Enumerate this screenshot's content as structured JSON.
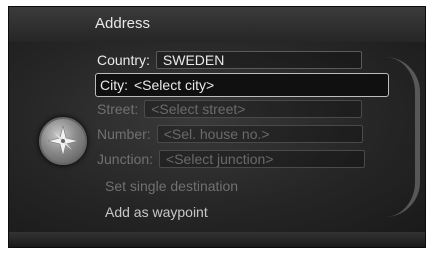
{
  "header": {
    "title": "Address"
  },
  "form": {
    "country": {
      "label": "Country:",
      "value": "SWEDEN"
    },
    "city": {
      "label": "City:",
      "value": "<Select city>"
    },
    "street": {
      "label": "Street:",
      "placeholder": "<Select street>"
    },
    "number": {
      "label": "Number:",
      "placeholder": "<Sel. house no.>"
    },
    "junction": {
      "label": "Junction:",
      "placeholder": "<Select junction>"
    }
  },
  "actions": {
    "set_single_destination": "Set single destination",
    "add_as_waypoint": "Add as waypoint"
  },
  "icons": {
    "navigation": "compass-knob-icon"
  },
  "colors": {
    "background": "#1c1c1c",
    "text_active": "#eaeaea",
    "text_disabled": "#707070"
  }
}
